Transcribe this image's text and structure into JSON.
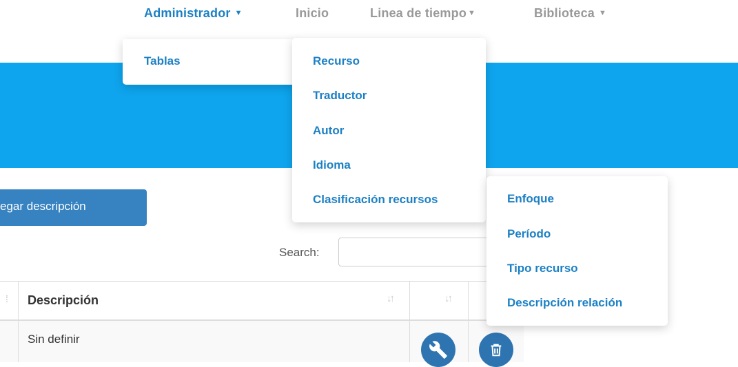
{
  "nav": {
    "administrador": "Administrador",
    "inicio": "Inicio",
    "linea": "Linea de tiempo",
    "biblioteca": "Biblioteca"
  },
  "menu_admin": {
    "tablas": "Tablas"
  },
  "menu_tablas": {
    "recurso": "Recurso",
    "traductor": "Traductor",
    "autor": "Autor",
    "idioma": "Idioma",
    "clasificacion": "Clasificación recursos"
  },
  "menu_clasificacion": {
    "enfoque": "Enfoque",
    "periodo": "Período",
    "tipo": "Tipo recurso",
    "descripcion_relacion": "Descripción relación"
  },
  "toolbar": {
    "add_label": "egar descripción"
  },
  "search": {
    "label": "Search:",
    "value": ""
  },
  "table": {
    "header_desc": "Descripción",
    "sort_glyph": "↓↑",
    "rows": [
      {
        "descripcion": "Sin definir"
      }
    ]
  },
  "colors": {
    "accent": "#1c80c4",
    "banner": "#0ea5ee",
    "button": "#3782c1",
    "action": "#2e74b0"
  },
  "icons": {
    "caret": "caret-down-icon",
    "sort": "sort-icon",
    "edit": "wrench-icon",
    "delete": "trash-icon"
  }
}
